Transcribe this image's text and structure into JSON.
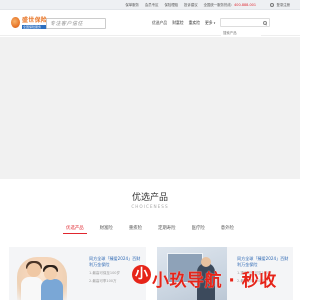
{
  "topbar": {
    "links": [
      "保单服务",
      "会员专区",
      "保险理赔",
      "投诉建议"
    ],
    "phone_label": "全国统一服务热线：",
    "phone": "400-888-001",
    "account": "登录注册"
  },
  "header": {
    "logo_brand": "盛世保险",
    "logo_sub": "全国保险服务",
    "slogan": "专注客户信任",
    "nav": [
      "优选产品",
      "财富险",
      "重疾险",
      "更多"
    ],
    "search_placeholder": "搜索产品"
  },
  "section": {
    "title": "优选产品",
    "subtitle": "CHOICENESS"
  },
  "tabs": [
    "优选产品",
    "财富险",
    "重疾险",
    "定期寿险",
    "医疗险",
    "意外险"
  ],
  "active_tab": 0,
  "cards": [
    {
      "title": "同方全球「臻爱2024」百财利万金保险",
      "lines": [
        "1.最高可保至100岁",
        "2.最高可享100万"
      ]
    },
    {
      "title": "同方全球「臻爱2024」百财利万金保险",
      "lines": [
        "1.重疾可保可至100岁",
        "2.最高可享100万"
      ]
    }
  ],
  "watermark": {
    "logo_char": "小",
    "text": "小玖导航 · 秒收"
  },
  "colors": {
    "accent": "#e0262e",
    "brand_orange": "#e8772a",
    "link_blue": "#2a66b3",
    "band_grey": "#f1f1f1"
  }
}
